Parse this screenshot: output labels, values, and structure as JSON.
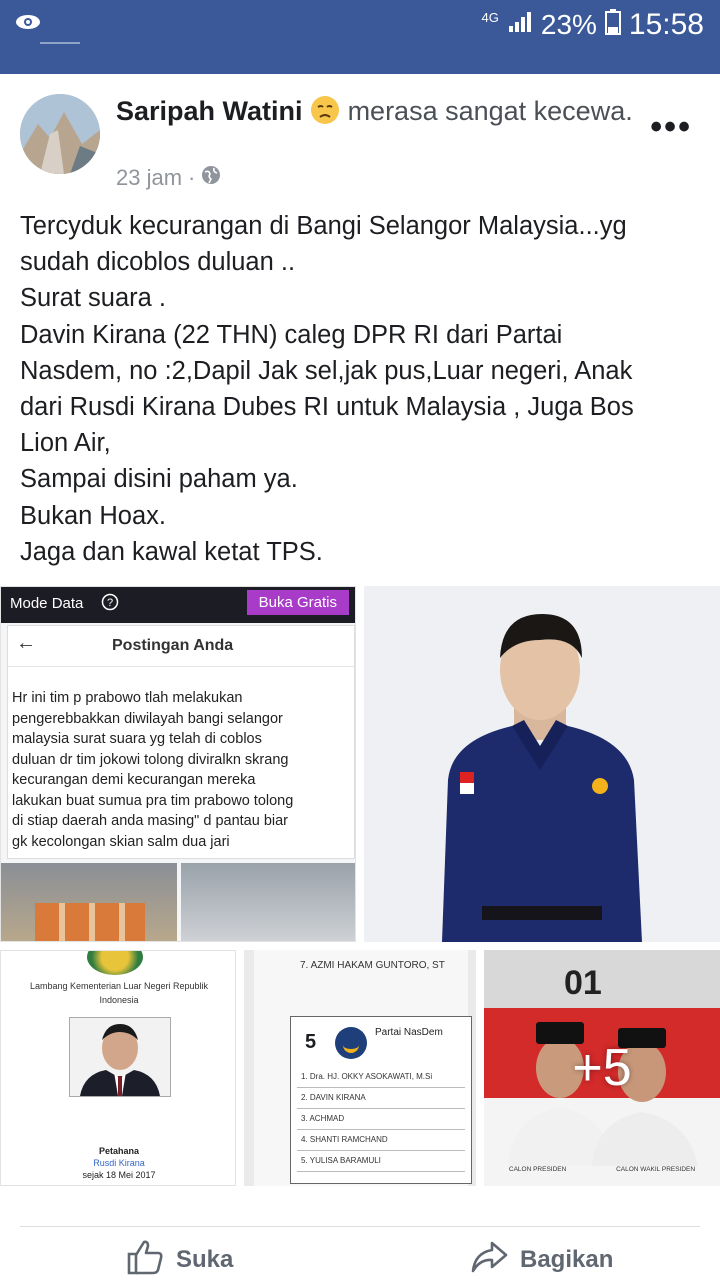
{
  "status_bar": {
    "network": "4G",
    "battery": "23%",
    "time": "15:58"
  },
  "post": {
    "author": "Saripah Watini",
    "feeling": "merasa sangat kecewa.",
    "time": "23 jam",
    "text_lines": [
      "Tercyduk kecurangan di Bangi Selangor Malaysia...yg",
      "sudah dicoblos duluan ..",
      "Surat suara .",
      "Davin Kirana (22 THN) caleg DPR RI dari Partai",
      "Nasdem, no :2,Dapil Jak sel,jak pus,Luar negeri, Anak",
      "dari Rusdi Kirana Dubes RI untuk Malaysia , Juga Bos",
      "Lion Air,",
      "Sampai disini paham ya.",
      "Bukan Hoax.",
      "Jaga dan kawal ketat TPS."
    ]
  },
  "image1": {
    "mode_label": "Mode Data",
    "button_label": "Buka Gratis",
    "header_title": "Postingan Anda",
    "body_lines": [
      "Hr ini tim p prabowo tlah melakukan",
      "pengerebbakkan diwilayah bangi selangor",
      "malaysia surat suara yg telah di coblos",
      "duluan dr tim jokowi tolong diviralkn skrang",
      "kecurangan demi kecurangan mereka",
      "lakukan  buat sumua pra tim prabowo tolong",
      "di stiap daerah anda masing\" d pantau biar",
      "gk kecolongan skian salm dua jari"
    ]
  },
  "image3": {
    "caption": "Lambang Kementerian Luar Negeri Republik Indonesia",
    "role": "Petahana",
    "name": "Rusdi Kirana",
    "since": "sejak 18 Mei 2017"
  },
  "image4": {
    "top_line": "7. AZMI HAKAM GUNTORO, ST",
    "number": "5",
    "party": "Partai NasDem",
    "candidates": [
      "1. Dra. HJ. OKKY ASOKAWATI, M.Si",
      "2. DAVIN KIRANA",
      "3. ACHMAD",
      "4. SHANTI RAMCHAND",
      "5. YULISA BARAMULI"
    ]
  },
  "image5": {
    "number": "01",
    "more_count": "+5",
    "caption_left": "CALON PRESIDEN",
    "caption_right": "CALON WAKIL PRESIDEN"
  },
  "actions": {
    "like": "Suka",
    "share": "Bagikan"
  }
}
